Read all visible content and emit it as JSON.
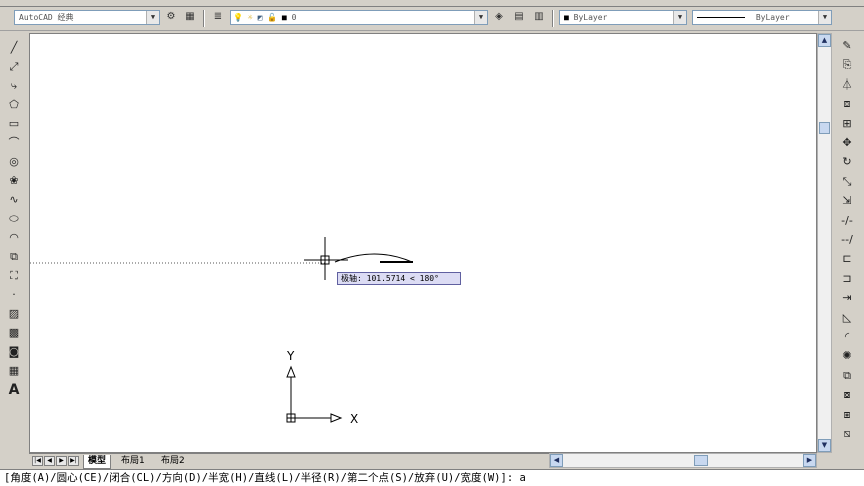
{
  "toolbar": {
    "workspace": "AutoCAD 经典",
    "layer": "0",
    "color": "ByLayer",
    "linetype": "ByLayer"
  },
  "layout_tabs": [
    {
      "label": "模型",
      "active": true
    },
    {
      "label": "布局1",
      "active": false
    },
    {
      "label": "布局2",
      "active": false
    }
  ],
  "tooltip": {
    "label": "极轴:",
    "value": "101.5714 < 180°"
  },
  "ucs": {
    "x_label": "X",
    "y_label": "Y"
  },
  "command_line": "[角度(A)/圆心(CE)/闭合(CL)/方向(D)/半宽(H)/直线(L)/半径(R)/第二个点(S)/放弃(U)/宽度(W)]: a",
  "left_tools": [
    "line-icon",
    "construction-line-icon",
    "polyline-icon",
    "polygon-icon",
    "rectangle-icon",
    "arc-icon",
    "circle-icon",
    "revision-cloud-icon",
    "spline-icon",
    "ellipse-icon",
    "ellipse-arc-icon",
    "insert-block-icon",
    "make-block-icon",
    "point-icon",
    "hatch-icon",
    "gradient-icon",
    "region-icon",
    "table-icon",
    "multiline-text-icon"
  ],
  "right_tools": [
    "erase-icon",
    "copy-icon",
    "mirror-icon",
    "offset-icon",
    "array-icon",
    "move-icon",
    "rotate-icon",
    "scale-icon",
    "stretch-icon",
    "trim-icon",
    "extend-icon",
    "break-at-point-icon",
    "break-icon",
    "join-icon",
    "chamfer-icon",
    "fillet-icon",
    "explode-icon",
    "draworder-front-icon",
    "draworder-back-icon",
    "draworder-above-icon",
    "draworder-below-icon"
  ]
}
